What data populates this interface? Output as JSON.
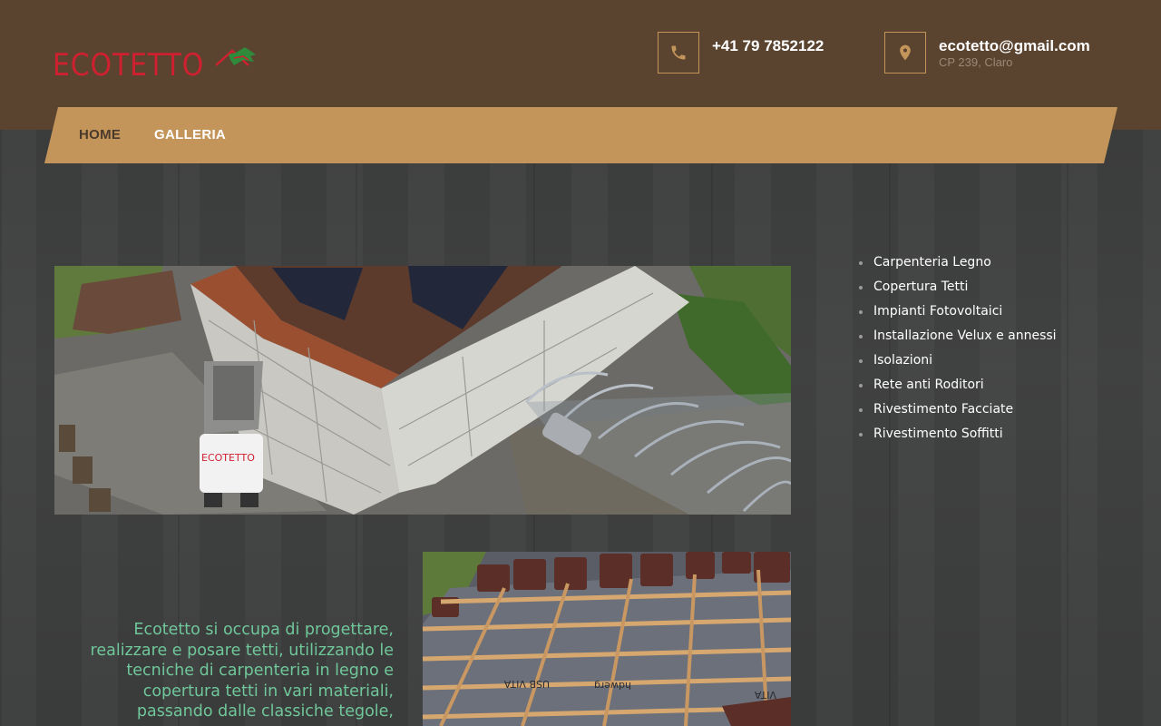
{
  "brand": {
    "logo_text": "ECOTETTO",
    "logo_color": "#cf2030",
    "roof_green": "#2f8a3b"
  },
  "contact": {
    "phone": "+41 79 7852122",
    "email": "ecotetto@gmail.com",
    "address": "CP 239, Claro",
    "phone_icon": "phone-icon",
    "location_icon": "map-pin-icon"
  },
  "nav": {
    "items": [
      {
        "label": "HOME"
      },
      {
        "label": "GALLERIA"
      }
    ]
  },
  "services": [
    {
      "label": "Carpenteria Legno"
    },
    {
      "label": "Copertura Tetti"
    },
    {
      "label": "Impianti Fotovoltaici"
    },
    {
      "label": "Installazione Velux e annessi"
    },
    {
      "label": "Isolazioni"
    },
    {
      "label": "Rete anti Roditori"
    },
    {
      "label": "Rivestimento Facciate"
    },
    {
      "label": "Rivestimento Soffitti"
    }
  ],
  "photos": {
    "truck_logo_text": "ECOTETTO",
    "membrane_text_1": "USB VITA",
    "membrane_text_2": "hdwerg",
    "membrane_text_3": "VITA"
  },
  "intro": {
    "text": "Ecotetto si occupa di progettare, realizzare e posare tetti, utilizzando le tecniche di carpenteria in legno e copertura tetti in vari materiali, passando dalle classiche tegole,"
  },
  "colors": {
    "header_bg": "#5a4430",
    "nav_bg": "#c4955a",
    "accent_text": "#6fc79a"
  }
}
